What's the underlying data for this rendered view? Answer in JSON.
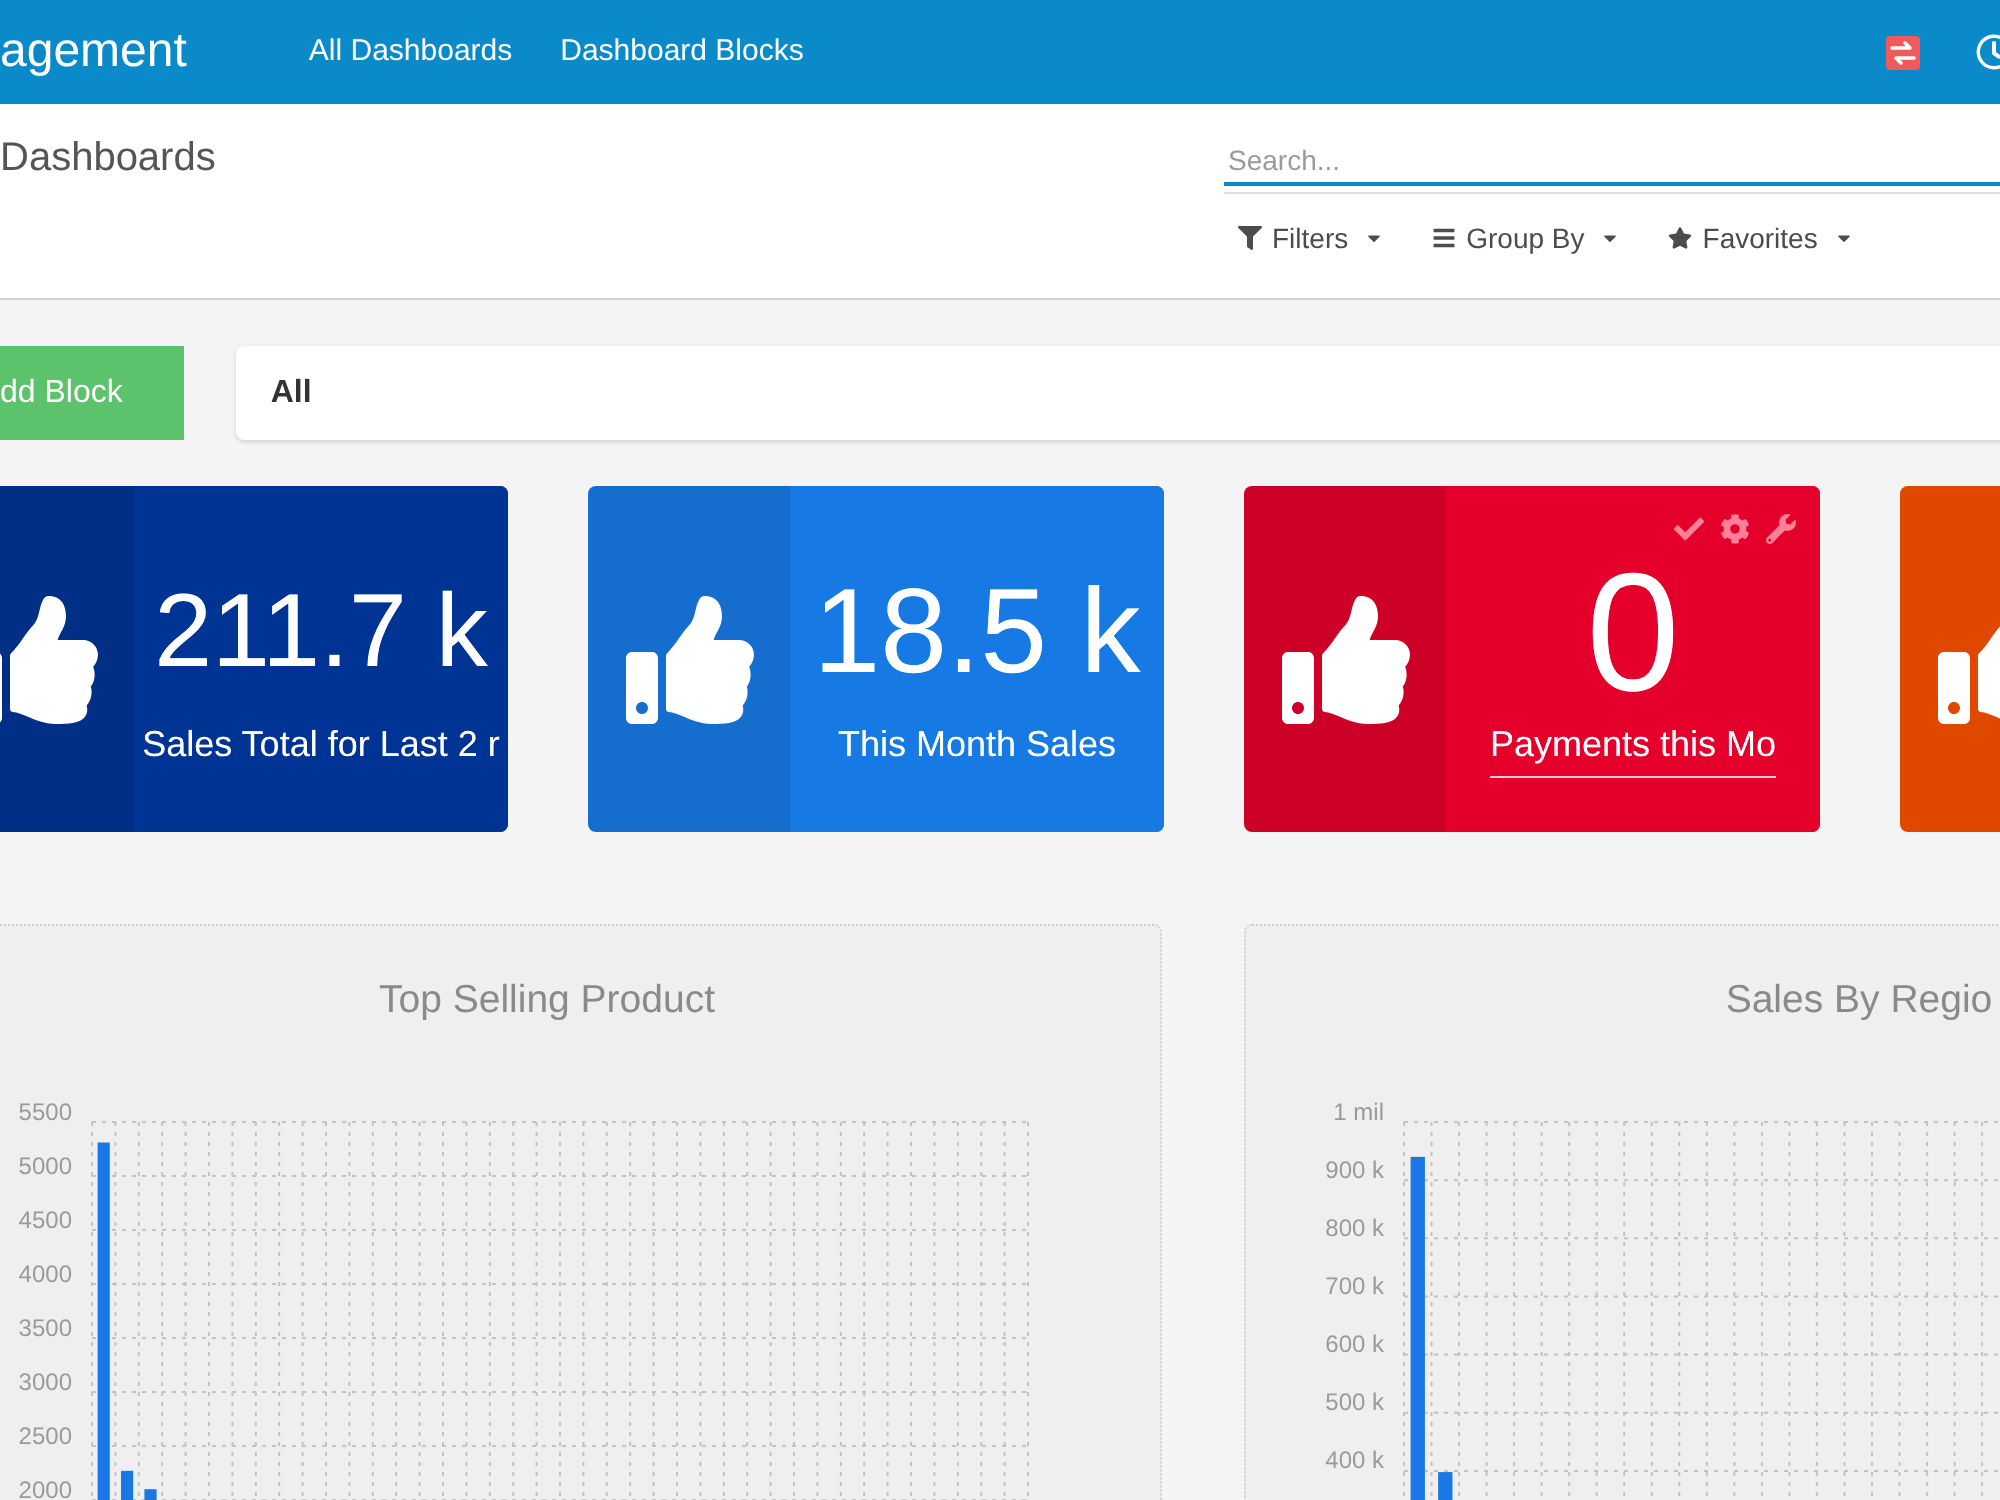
{
  "navbar": {
    "brand": "agement",
    "links": [
      "All Dashboards",
      "Dashboard Blocks"
    ]
  },
  "control_panel": {
    "breadcrumb": "Dashboards",
    "search": {
      "placeholder": "Search...",
      "focused": true
    },
    "buttons": [
      {
        "label": "Filters",
        "kind": "filter"
      },
      {
        "label": "Group By",
        "kind": "group"
      },
      {
        "label": "Favorites",
        "kind": "favorite"
      }
    ]
  },
  "toolbar": {
    "add_button": "dd Block",
    "filter": "All"
  },
  "tiles": [
    {
      "value": "211.7 k",
      "label": "Sales Total for Last 2 r",
      "color": "#002f85",
      "selected": false
    },
    {
      "value": "18.5 k",
      "label": "This Month Sales",
      "color": "#156dcd",
      "selected": false
    },
    {
      "value": "0",
      "label": "Payments this Mo",
      "color": "#cd0027",
      "selected": true
    },
    {
      "color": "#e04800"
    }
  ],
  "charts": [
    {
      "chart_data": {
        "type": "bar",
        "title": "Top Selling Product",
        "values": [
          5310,
          2270,
          2100,
          null,
          null,
          null,
          null,
          null,
          null,
          null,
          null,
          null,
          null,
          null,
          null,
          null,
          null,
          null,
          null,
          null,
          null,
          null,
          null,
          null,
          null,
          null,
          null,
          null,
          null,
          null,
          null,
          null,
          null,
          null,
          null,
          null,
          null,
          null,
          null,
          null
        ],
        "ylim": [
          2000,
          5500
        ],
        "yticks": [
          5500,
          5000,
          4500,
          4000,
          3500,
          3000,
          2500,
          2000
        ],
        "grid": true
      }
    },
    {
      "chart_data": {
        "type": "bar",
        "title": "Sales By Regio",
        "values": [
          0.94,
          0.398,
          null,
          null,
          null,
          null,
          null,
          null,
          null,
          null,
          null,
          null,
          null,
          null,
          null,
          null,
          null,
          null,
          null,
          null,
          null,
          null,
          null,
          null,
          null,
          null,
          null,
          null,
          null,
          null,
          null,
          null,
          null,
          null
        ],
        "ylim": [
          0.35,
          1
        ],
        "yticks": [
          {
            "value": 1,
            "label": "1 mil"
          },
          {
            "value": 0.9,
            "label": "900 k"
          },
          {
            "value": 0.8,
            "label": "800 k"
          },
          {
            "value": 0.7,
            "label": "700 k"
          },
          {
            "value": 0.6,
            "label": "600 k"
          },
          {
            "value": 0.5,
            "label": "500 k"
          },
          {
            "value": 0.4,
            "label": "400 k"
          }
        ],
        "grid": true
      }
    }
  ]
}
